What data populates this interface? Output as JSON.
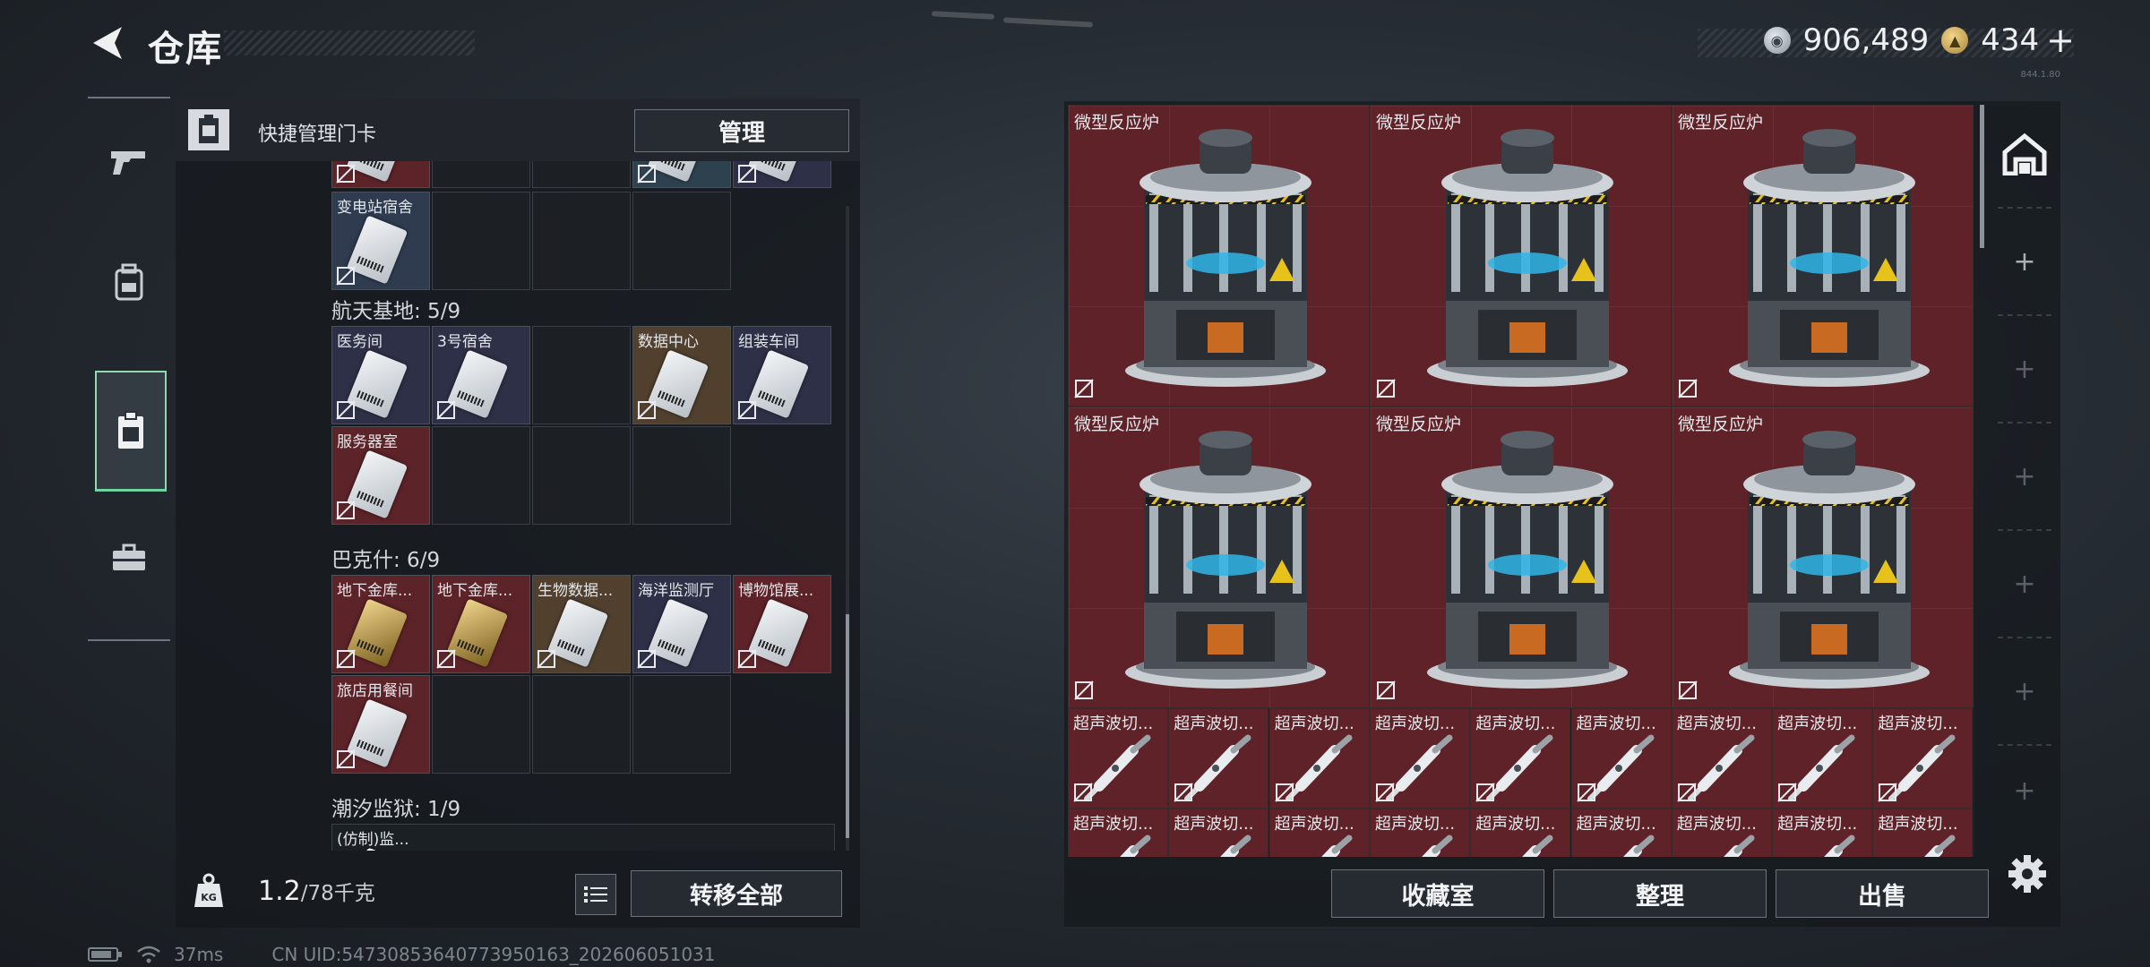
{
  "header": {
    "title": "仓库",
    "version": "844.1.80"
  },
  "currency": {
    "silver": "906,489",
    "gold": "434",
    "plus": "+"
  },
  "left_panel": {
    "header_text": "快捷管理门卡",
    "manage_button": "管理",
    "top_cards": [
      {
        "label": "",
        "bg": "red"
      },
      {
        "label": "",
        "bg": "empty"
      },
      {
        "label": "",
        "bg": "empty"
      },
      {
        "label": "",
        "bg": "teal"
      },
      {
        "label": "",
        "bg": "navy"
      },
      {
        "label": "变电站宿舍",
        "bg": "blue"
      }
    ],
    "categories": [
      {
        "name": "航天基地: 5/9",
        "cards": [
          {
            "label": "医务间",
            "bg": "navy"
          },
          {
            "label": "3号宿舍",
            "bg": "navy"
          },
          {
            "label": "",
            "bg": "empty"
          },
          {
            "label": "数据中心",
            "bg": "brown"
          },
          {
            "label": "组装车间",
            "bg": "navy"
          },
          {
            "label": "服务器室",
            "bg": "red"
          }
        ]
      },
      {
        "name": "巴克什: 6/9",
        "cards": [
          {
            "label": "地下金库...",
            "bg": "red",
            "gold": true
          },
          {
            "label": "地下金库...",
            "bg": "red",
            "gold": true
          },
          {
            "label": "生物数据...",
            "bg": "brown"
          },
          {
            "label": "海洋监测厅",
            "bg": "navy"
          },
          {
            "label": "博物馆展...",
            "bg": "red"
          },
          {
            "label": "旅店用餐间",
            "bg": "red"
          }
        ]
      },
      {
        "name": "潮汐监狱: 1/9",
        "cards": [
          {
            "label": "(仿制)监...",
            "bg": "empty"
          }
        ]
      }
    ],
    "weight_current": "1.2",
    "weight_max": "/78千克",
    "kg_label": "KG",
    "transfer_all": "转移全部"
  },
  "right_panel": {
    "large_items": [
      {
        "label": "微型反应炉"
      },
      {
        "label": "微型反应炉"
      },
      {
        "label": "微型反应炉"
      },
      {
        "label": "微型反应炉"
      },
      {
        "label": "微型反应炉"
      },
      {
        "label": "微型反应炉"
      }
    ],
    "small_items_row1": [
      "超声波切...",
      "超声波切...",
      "超声波切...",
      "超声波切...",
      "超声波切...",
      "超声波切...",
      "超声波切...",
      "超声波切...",
      "超声波切..."
    ],
    "small_items_row2": [
      "超声波切...",
      "超声波切...",
      "超声波切...",
      "超声波切...",
      "超声波切...",
      "超声波切...",
      "超声波切...",
      "超声波切...",
      "超声波切..."
    ],
    "side_plus": "+",
    "buttons": {
      "collection": "收藏室",
      "organize": "整理",
      "sell": "出售"
    }
  },
  "status_bar": {
    "ping": "37ms",
    "uid": "CN UID:54730853640773950163_202606051031"
  }
}
